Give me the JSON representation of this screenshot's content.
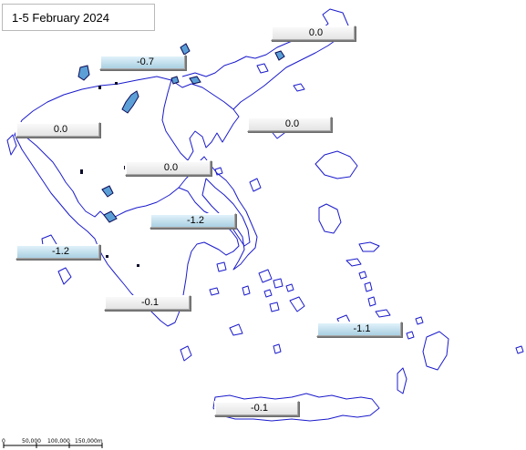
{
  "title": "1-5 February 2024",
  "colors": {
    "coastline": "#1a1acc",
    "island_fill": "#5b9fd6",
    "neutral_box": "#ececec",
    "negative_box": "#b8dcec"
  },
  "regions": [
    {
      "id": "thrace",
      "value": "0.0",
      "tone": "neutral"
    },
    {
      "id": "north-aegean-islands",
      "value": "-0.7",
      "tone": "negative"
    },
    {
      "id": "epirus-corfu",
      "value": "0.0",
      "tone": "neutral"
    },
    {
      "id": "central-macedonia",
      "value": "0.0",
      "tone": "neutral"
    },
    {
      "id": "thessaly",
      "value": "0.0",
      "tone": "neutral"
    },
    {
      "id": "attica-euboea",
      "value": "-1.2",
      "tone": "negative"
    },
    {
      "id": "ionian-islands",
      "value": "-1.2",
      "tone": "negative"
    },
    {
      "id": "peloponnese",
      "value": "-0.1",
      "tone": "neutral"
    },
    {
      "id": "dodecanese",
      "value": "-1.1",
      "tone": "negative"
    },
    {
      "id": "crete",
      "value": "-0.1",
      "tone": "neutral"
    }
  ],
  "scale_bar": {
    "labels": [
      "0",
      "50,000",
      "100,000",
      "150,000m"
    ]
  }
}
